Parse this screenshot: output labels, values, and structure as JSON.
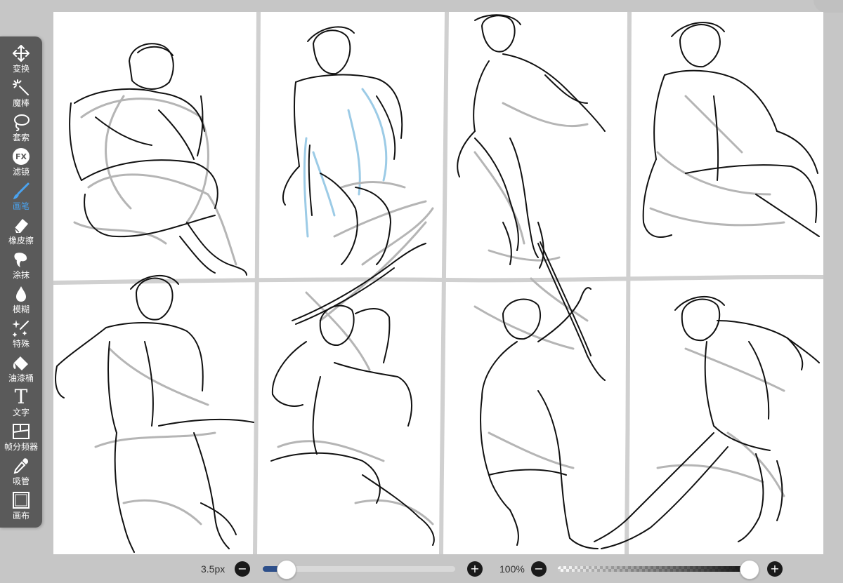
{
  "toolbar": {
    "active": "brush",
    "tools": [
      {
        "id": "transform",
        "label": "变换",
        "icon": "move-arrows-icon"
      },
      {
        "id": "magic-wand",
        "label": "魔棒",
        "icon": "magic-wand-icon"
      },
      {
        "id": "lasso",
        "label": "套索",
        "icon": "lasso-icon"
      },
      {
        "id": "filter",
        "label": "滤镜",
        "icon": "fx-icon",
        "glyph": "FX"
      },
      {
        "id": "brush",
        "label": "画笔",
        "icon": "brush-icon"
      },
      {
        "id": "eraser",
        "label": "橡皮擦",
        "icon": "eraser-icon"
      },
      {
        "id": "smudge",
        "label": "涂抹",
        "icon": "smudge-icon"
      },
      {
        "id": "blur",
        "label": "模糊",
        "icon": "blur-drop-icon"
      },
      {
        "id": "special",
        "label": "特殊",
        "icon": "special-sparkle-icon"
      },
      {
        "id": "fill",
        "label": "油漆桶",
        "icon": "paint-bucket-icon"
      },
      {
        "id": "text",
        "label": "文字",
        "icon": "text-icon",
        "glyph": "T"
      },
      {
        "id": "frame-divider",
        "label": "帧分频器",
        "icon": "frame-divider-icon"
      },
      {
        "id": "eyedropper",
        "label": "吸管",
        "icon": "eyedropper-icon"
      },
      {
        "id": "canvas",
        "label": "画布",
        "icon": "canvas-icon"
      }
    ]
  },
  "bottombar": {
    "brush_size_label": "3.5px",
    "brush_size_fraction": 0.12,
    "zoom_label": "100%",
    "opacity_fraction": 1.0,
    "minus_glyph": "−",
    "plus_glyph": "+"
  },
  "colors": {
    "toolbar_bg": "#5a5a5a",
    "active_tool": "#4aa3f0",
    "panel_divider": "#d0d0d0",
    "sketch_line": "#111111",
    "underdrawing": "#b5b5b5",
    "blue_sketch": "#9ccbe6",
    "slider_fill": "#2d4f8a"
  }
}
